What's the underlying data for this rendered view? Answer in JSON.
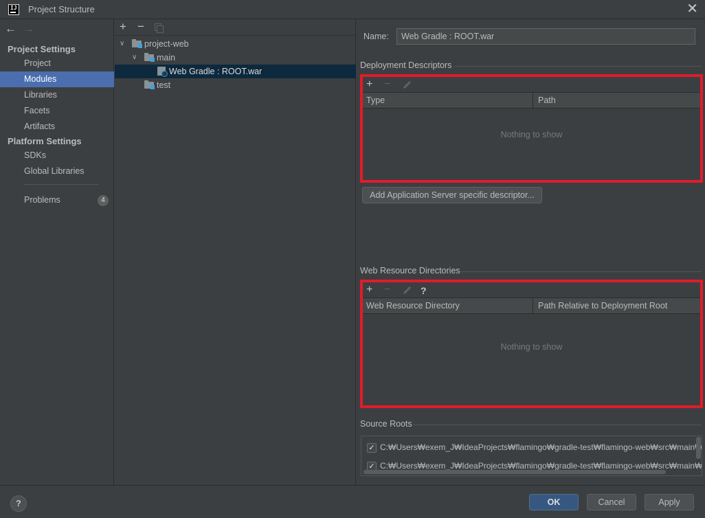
{
  "window": {
    "title": "Project Structure",
    "close_glyph": "✕"
  },
  "nav": {
    "back_glyph": "←",
    "forward_glyph": "→",
    "project_settings_title": "Project Settings",
    "platform_settings_title": "Platform Settings",
    "project_items": [
      {
        "label": "Project"
      },
      {
        "label": "Modules"
      },
      {
        "label": "Libraries"
      },
      {
        "label": "Facets"
      },
      {
        "label": "Artifacts"
      }
    ],
    "platform_items": [
      {
        "label": "SDKs"
      },
      {
        "label": "Global Libraries"
      }
    ],
    "problems": {
      "label": "Problems",
      "count": "4"
    },
    "selected": "Modules"
  },
  "tree": {
    "toolbar": {
      "add": "+",
      "remove": "−"
    },
    "rows": [
      {
        "label": "project-web",
        "chevron": "∨"
      },
      {
        "label": "main",
        "chevron": "∨"
      },
      {
        "label": "Web Gradle : ROOT.war"
      },
      {
        "label": "test"
      }
    ]
  },
  "facet": {
    "name_label": "Name:",
    "name_value": "Web Gradle : ROOT.war",
    "deployment_descriptors": {
      "title": "Deployment Descriptors",
      "columns": [
        "Type",
        "Path"
      ],
      "empty_text": "Nothing to show",
      "toolbar": {
        "add": "+",
        "remove": "−"
      }
    },
    "add_descriptor_button": "Add Application Server specific descriptor...",
    "web_resource_directories": {
      "title": "Web Resource Directories",
      "columns": [
        "Web Resource Directory",
        "Path Relative to Deployment Root"
      ],
      "empty_text": "Nothing to show",
      "toolbar": {
        "add": "+",
        "remove": "−",
        "help": "?"
      }
    },
    "source_roots": {
      "title": "Source Roots",
      "items": [
        {
          "checked": true,
          "path": "C:₩Users₩exem_J₩IdeaProjects₩flamingo₩gradle-test₩flamingo-web₩src₩main₩java"
        },
        {
          "checked": true,
          "path": "C:₩Users₩exem_J₩IdeaProjects₩flamingo₩gradle-test₩flamingo-web₩src₩main₩resou"
        }
      ]
    }
  },
  "footer": {
    "help": "?",
    "ok": "OK",
    "cancel": "Cancel",
    "apply": "Apply"
  },
  "colors": {
    "background": "#3c3f41",
    "selection": "#4b6eaf",
    "tree_selection": "#0d293e",
    "highlight_border": "#e21b2b",
    "primary_button": "#365880"
  },
  "icons": [
    "app-icon",
    "back-arrow-icon",
    "forward-arrow-icon",
    "close-icon",
    "add-icon",
    "remove-icon",
    "copy-icon",
    "edit-icon",
    "help-icon",
    "folder-icon",
    "module-folder-icon",
    "web-facet-icon",
    "checkbox-icon"
  ]
}
